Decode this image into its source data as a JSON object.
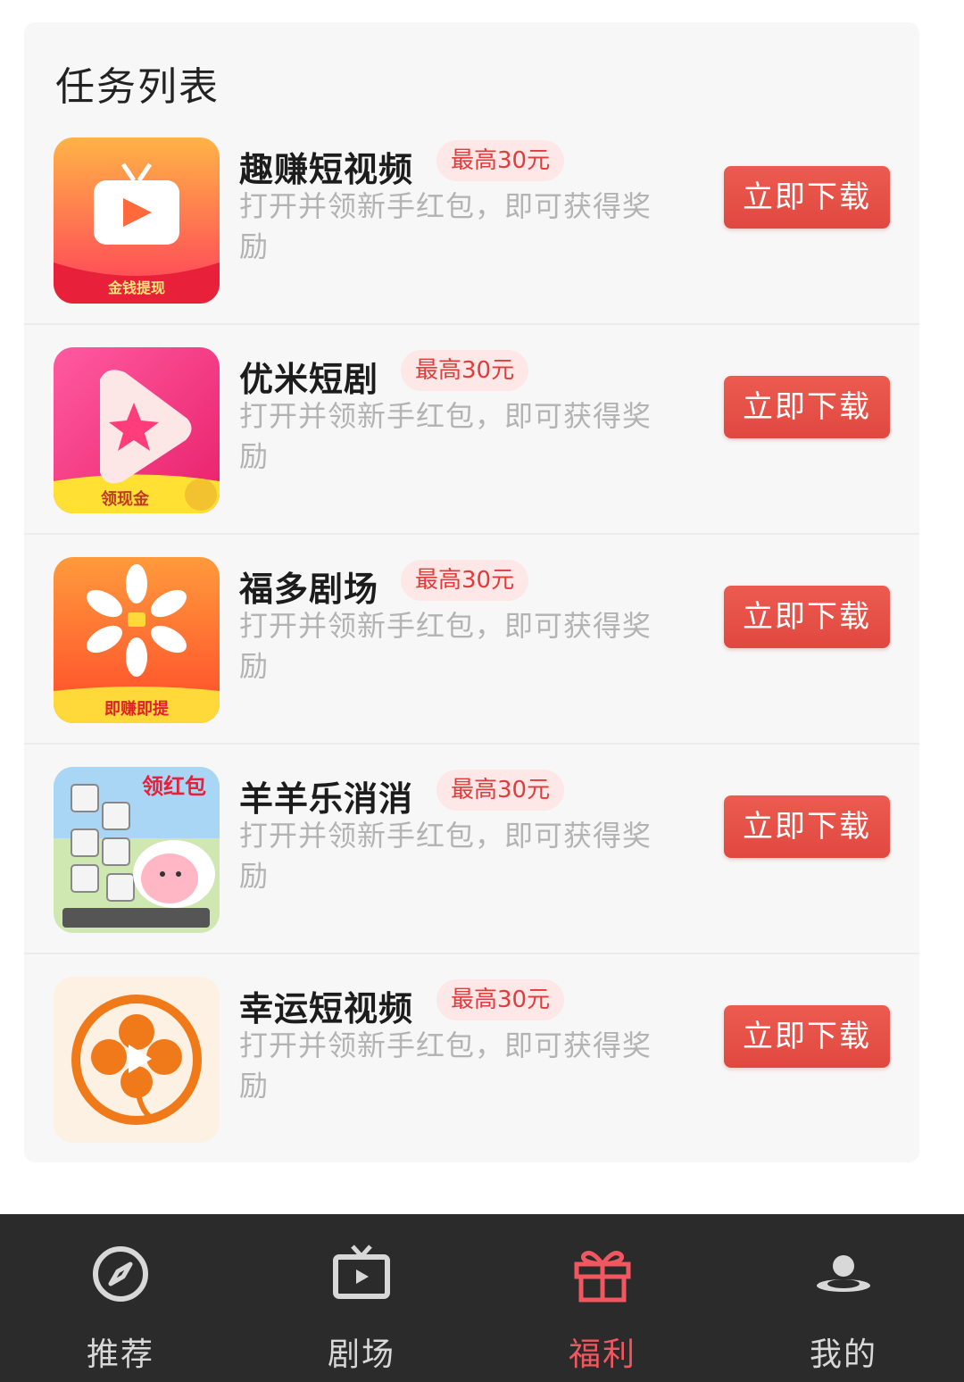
{
  "section": {
    "title": "任务列表"
  },
  "tasks": [
    {
      "name": "趣赚短视频",
      "badge": "最高30元",
      "desc": "打开并领新手红包，即可获得奖励",
      "button": "立即下载",
      "icon_text": "金钱提现"
    },
    {
      "name": "优米短剧",
      "badge": "最高30元",
      "desc": "打开并领新手红包，即可获得奖励",
      "button": "立即下载",
      "icon_text": "领现金"
    },
    {
      "name": "福多剧场",
      "badge": "最高30元",
      "desc": "打开并领新手红包，即可获得奖励",
      "button": "立即下载",
      "icon_text": "即赚即提"
    },
    {
      "name": "羊羊乐消消",
      "badge": "最高30元",
      "desc": "打开并领新手红包，即可获得奖励",
      "button": "立即下载",
      "icon_text": "领红包"
    },
    {
      "name": "幸运短视频",
      "badge": "最高30元",
      "desc": "打开并领新手红包，即可获得奖励",
      "button": "立即下载",
      "icon_text": ""
    }
  ],
  "nav": {
    "items": [
      {
        "label": "推荐",
        "icon": "compass-icon",
        "active": false
      },
      {
        "label": "剧场",
        "icon": "tv-icon",
        "active": false
      },
      {
        "label": "福利",
        "icon": "gift-icon",
        "active": true
      },
      {
        "label": "我的",
        "icon": "user-icon",
        "active": false
      }
    ]
  },
  "colors": {
    "accent": "#e04840",
    "active_nav": "#f0575f",
    "nav_bg": "#2b2b2b"
  }
}
